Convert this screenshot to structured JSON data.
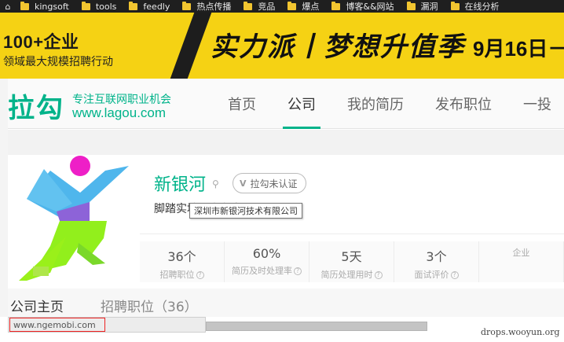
{
  "bookmarks_bar": {
    "items": [
      {
        "label": "kingsoft"
      },
      {
        "label": "tools"
      },
      {
        "label": "feedly"
      },
      {
        "label": "热点传播"
      },
      {
        "label": "竞品"
      },
      {
        "label": "爆点"
      },
      {
        "label": "博客&&网站"
      },
      {
        "label": "漏洞"
      },
      {
        "label": "在线分析"
      }
    ]
  },
  "banner": {
    "line1": "100+企业",
    "line2": "领域最大规模招聘行动",
    "slogan": "实力派丨梦想升值季",
    "date": "9月16日－"
  },
  "header": {
    "logo_text": "拉勾",
    "logo_slogan": "专注互联网职业机会",
    "logo_url": "www.lagou.com",
    "nav": [
      {
        "label": "首页"
      },
      {
        "label": "公司"
      },
      {
        "label": "我的简历"
      },
      {
        "label": "发布职位"
      },
      {
        "label": "一投"
      }
    ],
    "accent_color": "#00b38a"
  },
  "company": {
    "name": "新银河",
    "badge": "拉勾未认证",
    "badge_icon": "V",
    "tagline": "脚踏实地，患有音运",
    "tooltip": "深圳市新银河技术有限公司",
    "stats": [
      {
        "value": "36个",
        "label": "招聘职位"
      },
      {
        "value": "60%",
        "label": "简历及时处理率"
      },
      {
        "value": "5天",
        "label": "简历处理用时"
      },
      {
        "value": "3个",
        "label": "面试评价"
      },
      {
        "value": "",
        "label": "企业"
      }
    ]
  },
  "tabs": {
    "home": "公司主页",
    "jobs": "招聘职位（36）"
  },
  "status_bar": {
    "url": "www.ngemobi.com",
    "watermark": "drops.wooyun.org"
  }
}
